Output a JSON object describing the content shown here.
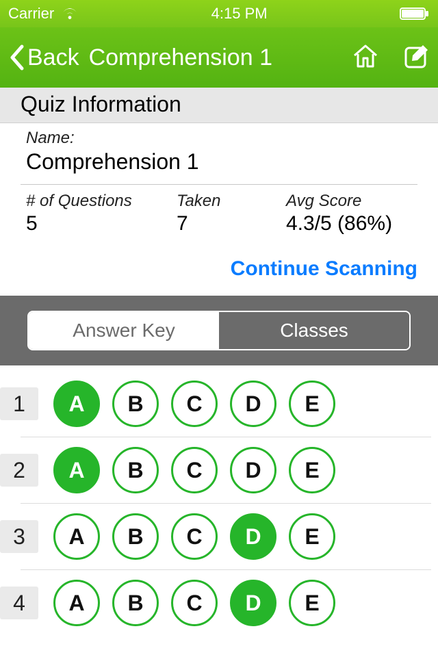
{
  "status": {
    "carrier": "Carrier",
    "time": "4:15 PM"
  },
  "nav": {
    "back": "Back",
    "title": "Comprehension 1"
  },
  "section": {
    "header": "Quiz Information"
  },
  "info": {
    "name_label": "Name:",
    "name": "Comprehension 1",
    "stats": {
      "questions_label": "# of Questions",
      "questions": "5",
      "taken_label": "Taken",
      "taken": "7",
      "avg_label": "Avg Score",
      "avg": "4.3/5 (86%)"
    }
  },
  "continue_label": "Continue Scanning",
  "tabs": {
    "answer_key": "Answer Key",
    "classes": "Classes"
  },
  "options": [
    "A",
    "B",
    "C",
    "D",
    "E"
  ],
  "questions": [
    {
      "n": "1",
      "selected": "A"
    },
    {
      "n": "2",
      "selected": "A"
    },
    {
      "n": "3",
      "selected": "D"
    },
    {
      "n": "4",
      "selected": "D"
    }
  ]
}
